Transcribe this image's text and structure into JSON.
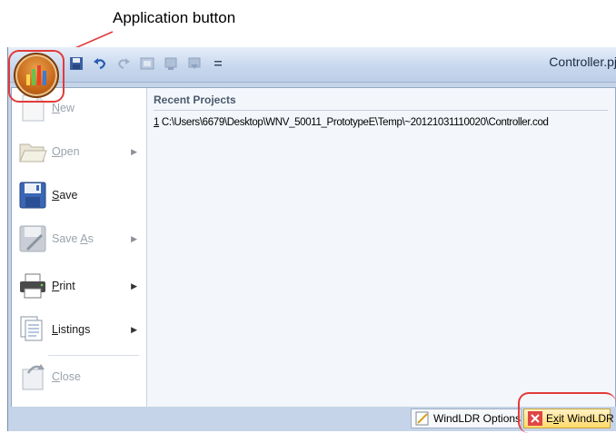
{
  "annotation": {
    "label": "Application button"
  },
  "titlebar": {
    "title": "Controller.pj"
  },
  "menu": {
    "items": [
      {
        "key": "N",
        "rest": "ew",
        "has_arrow": false,
        "enabled": false
      },
      {
        "key": "O",
        "rest": "pen",
        "has_arrow": true,
        "enabled": false
      },
      {
        "key": "S",
        "rest": "ave",
        "has_arrow": false,
        "enabled": true
      },
      {
        "key_prefix": "Save ",
        "key": "A",
        "rest": "s",
        "has_arrow": true,
        "enabled": false
      },
      {
        "key": "P",
        "rest": "rint",
        "has_arrow": true,
        "enabled": true
      },
      {
        "key": "L",
        "rest": "istings",
        "has_arrow": true,
        "enabled": true
      },
      {
        "key": "C",
        "rest": "lose",
        "has_arrow": false,
        "enabled": false
      }
    ],
    "recent": {
      "title": "Recent Projects",
      "items": [
        {
          "index": "1",
          "path": "C:\\Users\\6679\\Desktop\\WNV_50011_PrototypeE\\Temp\\~20121031110020\\Controller.cod"
        }
      ]
    }
  },
  "bottom": {
    "options_label": "WindLDR Options",
    "exit_key": "x",
    "exit_pre": "E",
    "exit_rest": "it WindLDR"
  },
  "colors": {
    "annotation_red": "#e23a3a",
    "orb": "#c9691b",
    "exit_bg": "#ffd96b"
  }
}
